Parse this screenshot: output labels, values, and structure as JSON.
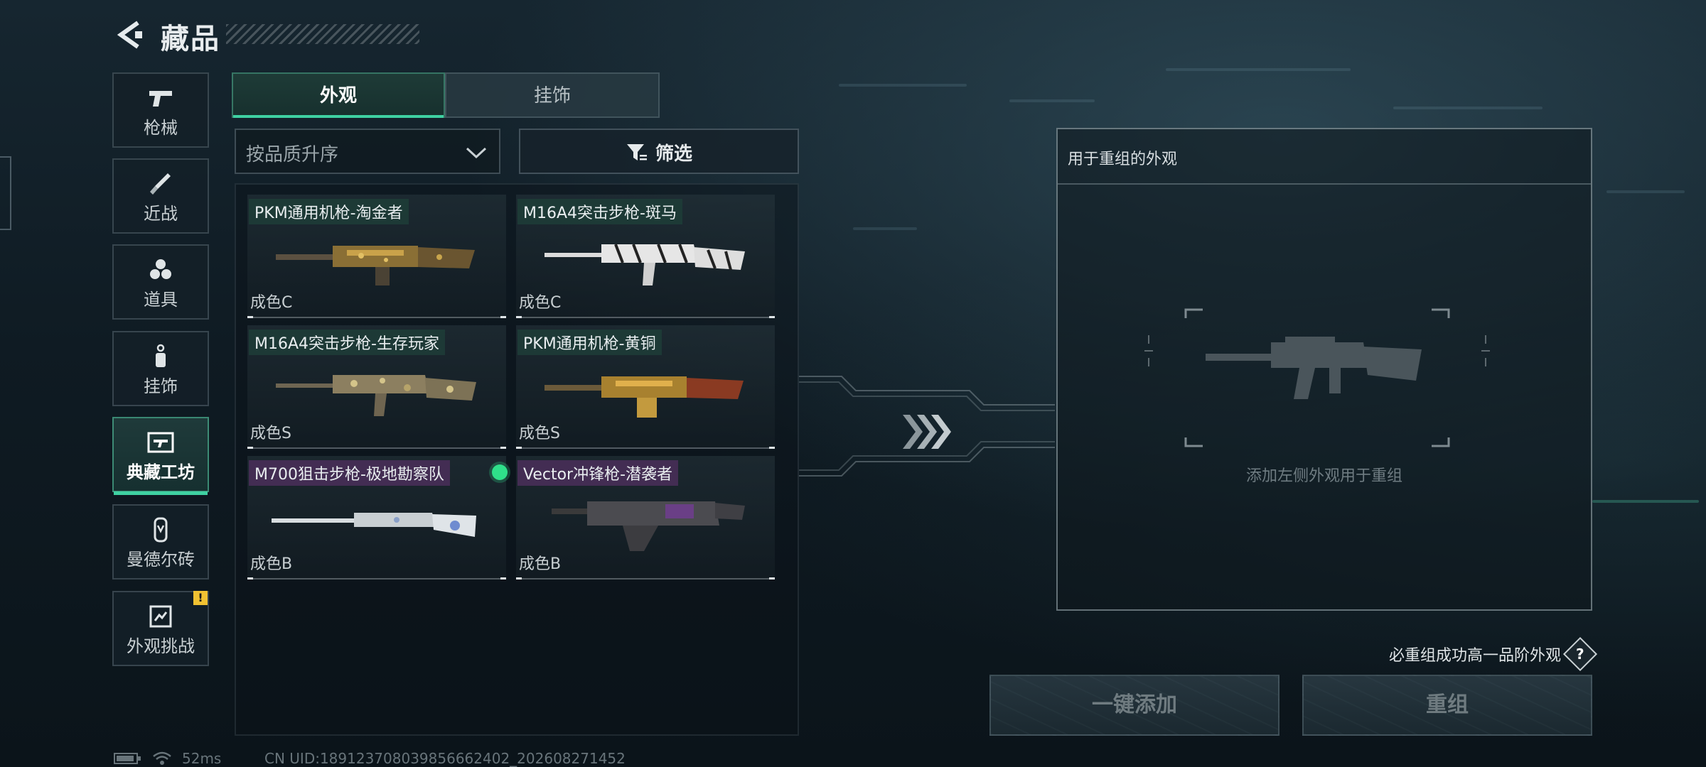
{
  "header": {
    "title": "藏品"
  },
  "sidebar": {
    "items": [
      {
        "label": "枪械",
        "icon": "pistol-icon"
      },
      {
        "label": "近战",
        "icon": "knife-icon"
      },
      {
        "label": "道具",
        "icon": "grenade-icon"
      },
      {
        "label": "挂饰",
        "icon": "charm-icon"
      },
      {
        "label": "典藏工坊",
        "icon": "workshop-icon",
        "active": true
      },
      {
        "label": "曼德尔砖",
        "icon": "brick-icon"
      },
      {
        "label": "外观挑战",
        "icon": "challenge-icon",
        "badge": "!"
      }
    ]
  },
  "tabs": [
    {
      "label": "外观",
      "active": true
    },
    {
      "label": "挂饰",
      "active": false
    }
  ],
  "sort": {
    "label": "按品质升序"
  },
  "filter": {
    "label": "筛选"
  },
  "items": [
    {
      "name": "PKM通用机枪-淘金者",
      "grade": "成色C",
      "skin": "gold-camo"
    },
    {
      "name": "M16A4突击步枪-斑马",
      "grade": "成色C",
      "skin": "zebra"
    },
    {
      "name": "M16A4突击步枪-生存玩家",
      "grade": "成色S",
      "skin": "survival-camo"
    },
    {
      "name": "PKM通用机枪-黄铜",
      "grade": "成色S",
      "skin": "brass"
    },
    {
      "name": "M700狙击步枪-极地勘察队",
      "grade": "成色B",
      "skin": "arctic",
      "indicator": true
    },
    {
      "name": "Vector冲锋枪-潜袭者",
      "grade": "成色B",
      "skin": "purple"
    }
  ],
  "recompose": {
    "header": "用于重组的外观",
    "hint": "添加左侧外观用于重组",
    "note": "必重组成功高一品阶外观",
    "help": "?",
    "add_button": "一键添加",
    "recompose_button": "重组"
  },
  "status": {
    "ping": "52ms",
    "uid": "CN UID:18912370803985666240​2_202608271452"
  },
  "colors": {
    "accent": "#3fd1a2",
    "indicator": "#2fe08a",
    "warning": "#f1c232"
  }
}
